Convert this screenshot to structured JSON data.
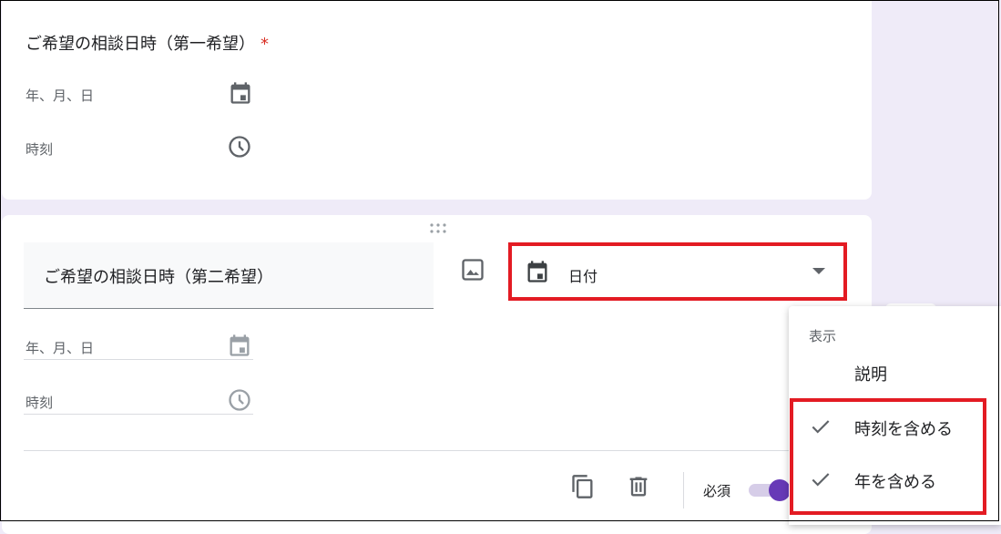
{
  "card1": {
    "title": "ご希望の相談日時（第一希望）",
    "required_mark": "*",
    "date_placeholder": "年、月、日",
    "time_placeholder": "時刻"
  },
  "card2": {
    "title": "ご希望の相談日時（第二希望）",
    "type_selected": "日付",
    "date_placeholder": "年、月、日",
    "time_placeholder": "時刻",
    "required_label": "必須",
    "required_on": true
  },
  "menu": {
    "header": "表示",
    "items": [
      {
        "label": "説明",
        "checked": false
      },
      {
        "label": "時刻を含める",
        "checked": true
      },
      {
        "label": "年を含める",
        "checked": true
      }
    ]
  },
  "colors": {
    "accent": "#673ab7",
    "highlight": "#e31b23",
    "background": "#efebf8"
  },
  "icons": [
    "calendar-icon",
    "clock-icon",
    "image-icon",
    "drag-handle-icon",
    "dropdown-arrow-icon",
    "copy-icon",
    "trash-icon",
    "check-icon"
  ]
}
